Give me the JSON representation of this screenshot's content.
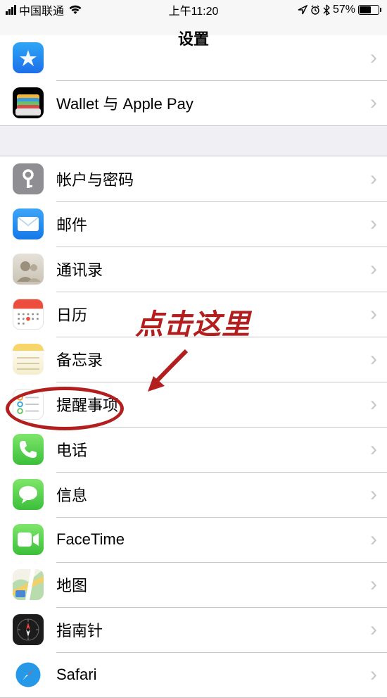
{
  "status": {
    "carrier": "中国联通",
    "time": "上午11:20",
    "battery_pct": "57%"
  },
  "nav": {
    "title": "设置"
  },
  "section1": {
    "row0_label": "",
    "row1_label": "Wallet 与 Apple Pay"
  },
  "section2": {
    "items": [
      {
        "label": "帐户与密码"
      },
      {
        "label": "邮件"
      },
      {
        "label": "通讯录"
      },
      {
        "label": "日历"
      },
      {
        "label": "备忘录"
      },
      {
        "label": "提醒事项"
      },
      {
        "label": "电话"
      },
      {
        "label": "信息"
      },
      {
        "label": "FaceTime"
      },
      {
        "label": "地图"
      },
      {
        "label": "指南针"
      },
      {
        "label": "Safari"
      }
    ]
  },
  "annotation": {
    "text": "点击这里"
  }
}
